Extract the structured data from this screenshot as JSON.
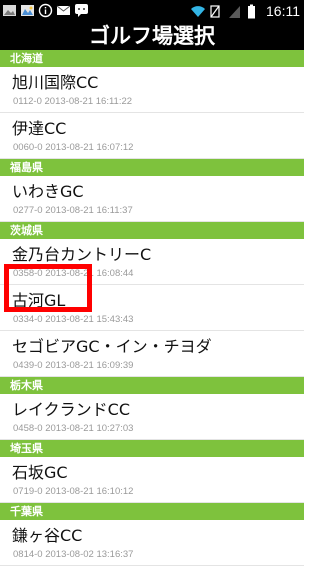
{
  "status_bar": {
    "left_icons": [
      "image-icon",
      "gallery-icon",
      "info-icon",
      "mail-icon",
      "message-icon"
    ],
    "right_icons": [
      "wifi-icon",
      "no-sim-icon",
      "signal-icon",
      "battery-icon"
    ],
    "time": "16:11"
  },
  "header": {
    "title": "ゴルフ場選択"
  },
  "sections": [
    {
      "label": "北海道",
      "items": [
        {
          "name": "旭川国際CC",
          "meta": "0112-0 2013-08-21 16:11:22"
        },
        {
          "name": "伊達CC",
          "meta": "0060-0 2013-08-21 16:07:12"
        }
      ]
    },
    {
      "label": "福島県",
      "items": [
        {
          "name": "いわきGC",
          "meta": "0277-0 2013-08-21 16:11:37"
        }
      ]
    },
    {
      "label": "茨城県",
      "items": [
        {
          "name": "金乃台カントリーC",
          "meta": "0358-0 2013-08-21 16:08:44"
        },
        {
          "name": "古河GL",
          "meta": "0334-0 2013-08-21 15:43:43"
        },
        {
          "name": "セゴビアGC・イン・チヨダ",
          "meta": "0439-0 2013-08-21 16:09:39"
        }
      ]
    },
    {
      "label": "栃木県",
      "items": [
        {
          "name": "レイクランドCC",
          "meta": "0458-0 2013-08-21 10:27:03"
        }
      ]
    },
    {
      "label": "埼玉県",
      "items": [
        {
          "name": "石坂GC",
          "meta": "0719-0 2013-08-21 16:10:12"
        }
      ]
    },
    {
      "label": "千葉県",
      "items": [
        {
          "name": "鎌ヶ谷CC",
          "meta": "0814-0 2013-08-02 13:16:37"
        }
      ]
    }
  ],
  "colors": {
    "section_header_bg": "#7ec23d",
    "highlight": "#ff0000",
    "background": "#ffffff"
  }
}
